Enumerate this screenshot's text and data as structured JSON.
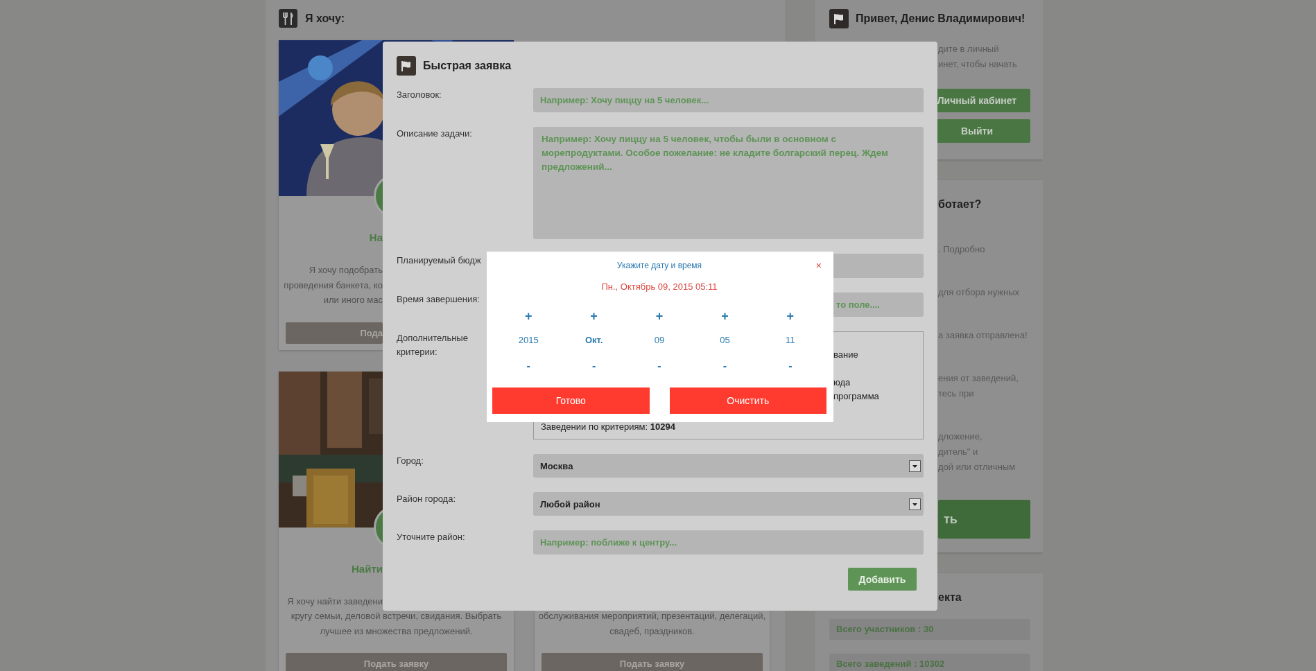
{
  "main_panel": {
    "title": "Я хочу:",
    "cards": [
      {
        "heading": "На",
        "lines": [
          "Я хочу подобрать",
          "проведения банкета, ко",
          "или иного мас"
        ],
        "button": "Пода"
      },
      {
        "heading": "Найти",
        "lines": [
          "Я хочу найти заведени",
          "кругу семьи, деловой встречи, свидания. Выбрать",
          "лучшее из множества предложений."
        ],
        "button": "Подать заявку"
      },
      {
        "lines": [
          "обслуживания мероприятий, презентаций, делегаций,",
          "свадеб, праздников."
        ],
        "button": "Подать заявку"
      }
    ]
  },
  "sidebar": [
    {
      "kind": "greeting",
      "title": "Привет, Денис Владимирович!",
      "lines": [
        "дите в личный",
        "инет, чтобы начать"
      ],
      "buttons": [
        "Личный кабинет",
        "Выйти"
      ]
    },
    {
      "kind": "info",
      "title": "ботает?",
      "paragraphs": [
        [
          ". Подробно"
        ],
        [
          "для отбора нужных"
        ],
        [
          "а заявка отправлена!"
        ],
        [
          "ения от заведений,",
          "тесь при"
        ],
        [
          "дложение,",
          "дитель\" и",
          "дой или отличным"
        ]
      ],
      "button": "ть"
    },
    {
      "kind": "stats",
      "title": "екта",
      "stats": [
        "Всего участников : 30",
        "Всего заведений : 10302"
      ]
    }
  ],
  "modal": {
    "title": "Быстрая заявка",
    "rows": [
      {
        "kind": "input",
        "label": "Заголовок:",
        "placeholder": "Например: Хочу пиццу на 5 человек..."
      },
      {
        "kind": "textarea",
        "label": "Описание задачи:",
        "placeholder": "Например: Хочу пиццу на 5 человек, чтобы были в основном с морепродуктами. Особое пожелание: не кладите болгарский перец. Ждем предложений..."
      },
      {
        "kind": "input",
        "label": "Планируемый бюдж"
      },
      {
        "kind": "input",
        "label": "Время завершения:",
        "placeholder": "то поле...."
      },
      {
        "kind": "criteria",
        "label": "Дополнительные критерии:",
        "items": [
          "вание",
          "юда",
          "программа"
        ],
        "count": "Заведении по критериям: **10294**"
      },
      {
        "kind": "select",
        "label": "Город:",
        "value": "Москва"
      },
      {
        "kind": "select",
        "label": "Район города:",
        "value": "Любой район"
      },
      {
        "kind": "input",
        "label": "Уточните район:",
        "placeholder": "Например: поближе к центру..."
      }
    ],
    "submit": "Добавить"
  },
  "date_picker": {
    "title": "Укажите дату и время",
    "close": "×",
    "date": "Пн., Октябрь 09, 2015 05:11",
    "columns": [
      {
        "increment": "+",
        "value": "2015",
        "decrement": "-",
        "selected": false
      },
      {
        "increment": "+",
        "value": "Окт.",
        "decrement": "-",
        "selected": true
      },
      {
        "increment": "+",
        "value": "09",
        "decrement": "-",
        "selected": false
      },
      {
        "increment": "+",
        "value": "05",
        "decrement": "-",
        "selected": false
      },
      {
        "increment": "+",
        "value": "11",
        "decrement": "-",
        "selected": false
      }
    ],
    "buttons": [
      "Готово",
      "Очистить"
    ]
  }
}
